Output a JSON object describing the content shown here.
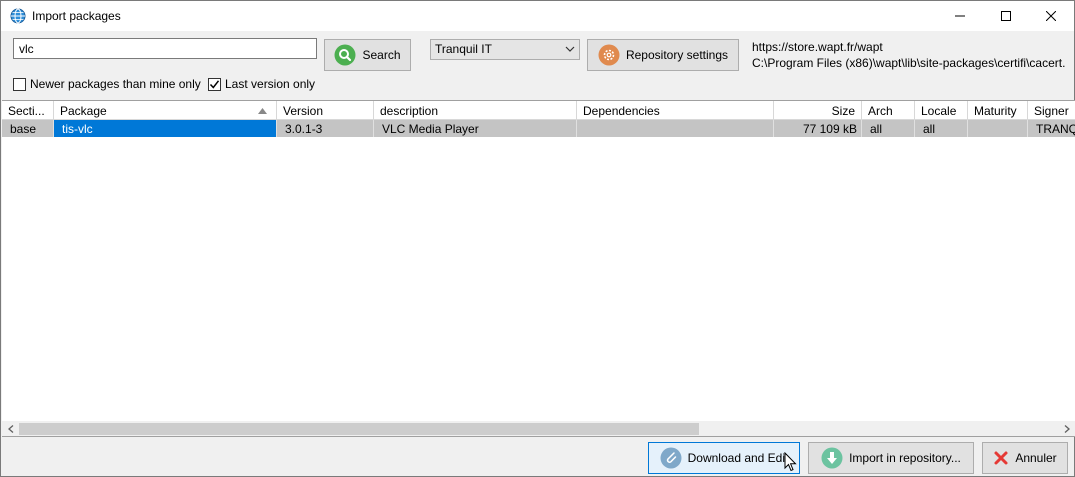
{
  "window": {
    "title": "Import packages",
    "icon": "globe-icon"
  },
  "toolbar": {
    "search_value": "vlc",
    "search_label": "Search",
    "repository_selected": "Tranquil IT",
    "repo_settings_label": "Repository settings",
    "repo_url": "https://store.wapt.fr/wapt",
    "cert_path": "C:\\Program Files (x86)\\wapt\\lib\\site-packages\\certifi\\cacert.",
    "checkbox_newer_label": "Newer packages than mine only",
    "checkbox_newer_checked": false,
    "checkbox_last_label": "Last version only",
    "checkbox_last_checked": true
  },
  "grid": {
    "columns": [
      "Secti...",
      "Package",
      "Version",
      "description",
      "Dependencies",
      "Size",
      "Arch",
      "Locale",
      "Maturity",
      "Signer"
    ],
    "sort_column": "Package",
    "rows": [
      {
        "section": "base",
        "package": "tis-vlc",
        "version": "3.0.1-3",
        "description": "VLC Media Player",
        "dependencies": "",
        "size": "77 109 kB",
        "arch": "all",
        "locale": "all",
        "maturity": "",
        "signer": "TRANQ"
      }
    ]
  },
  "footer": {
    "download_edit_label": "Download and Edit",
    "import_label": "Import in repository...",
    "cancel_label": "Annuler"
  },
  "colors": {
    "selection": "#0078d7",
    "row_bg": "#c4c4c4",
    "search_icon": "#4caf50",
    "settings_icon": "#e08a4e",
    "cancel_icon": "#e53935"
  }
}
